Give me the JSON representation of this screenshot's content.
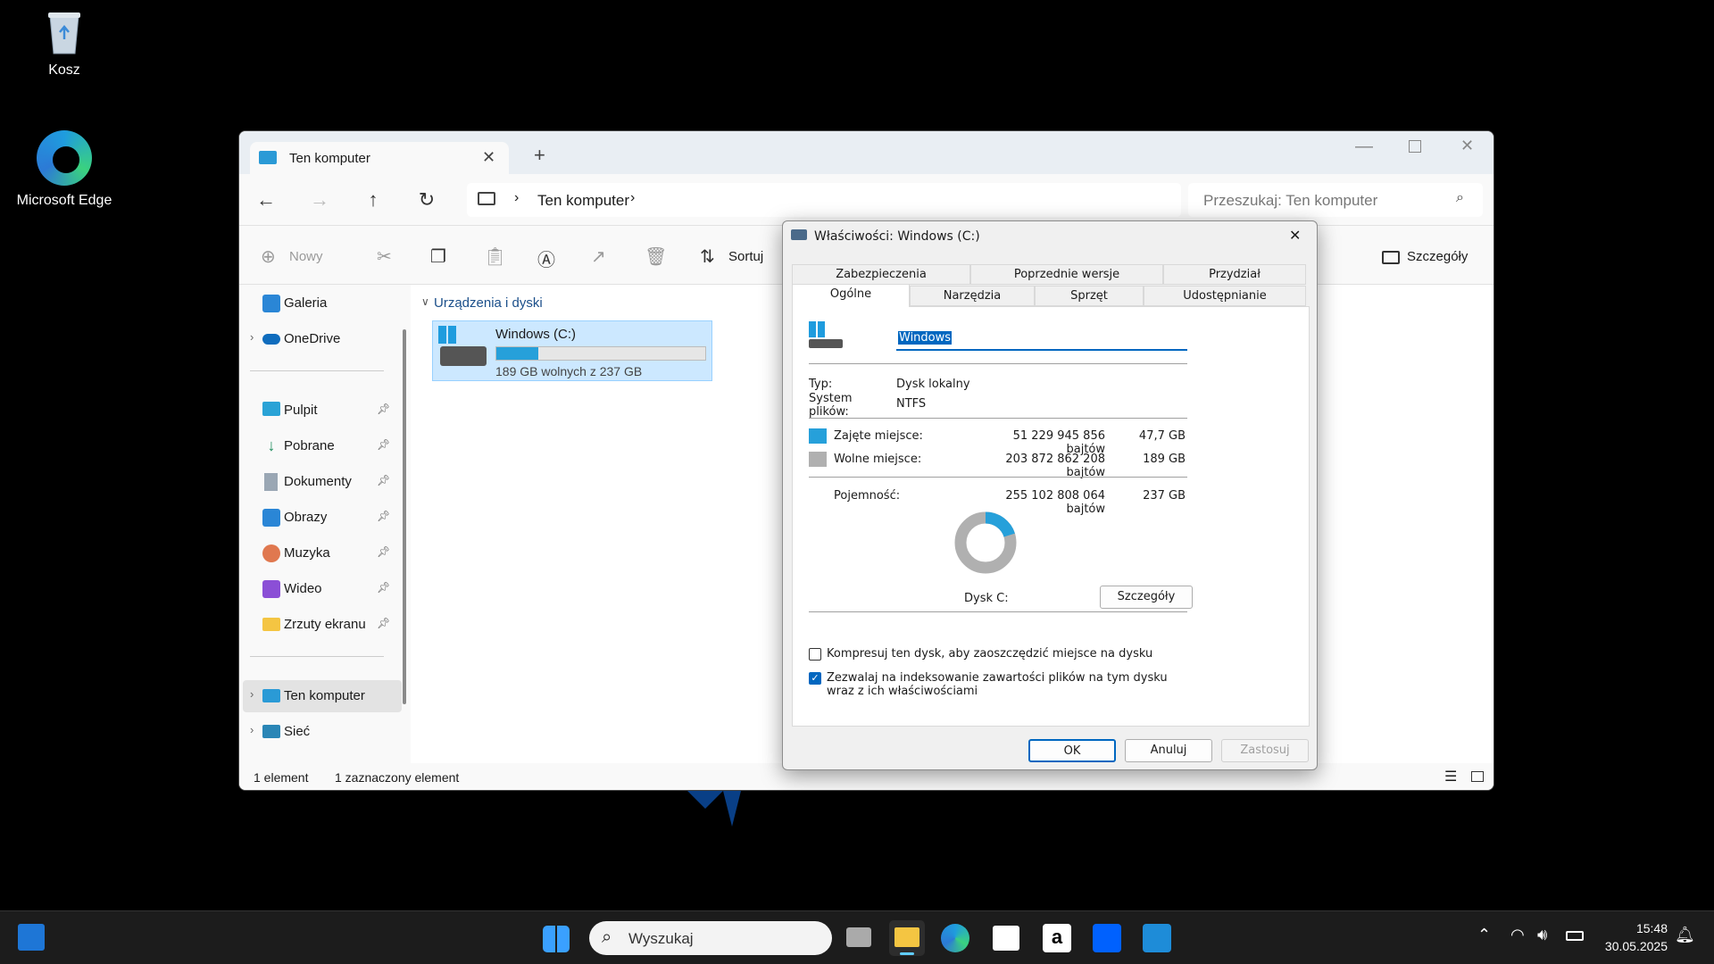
{
  "desktop": {
    "icons": [
      {
        "label": "Kosz",
        "icon": "recycle-bin-icon"
      },
      {
        "label": "Microsoft Edge",
        "icon": "edge-icon"
      }
    ]
  },
  "explorer": {
    "tab_title": "Ten komputer",
    "breadcrumb": [
      "Ten komputer"
    ],
    "search_placeholder": "Przeszukaj: Ten komputer",
    "toolbar": {
      "new_label": "Nowy",
      "sort_label": "Sortuj",
      "details_label": "Szczegóły"
    },
    "sidebar": {
      "top": [
        {
          "label": "Galeria",
          "icon": "gallery-icon",
          "chevron": false
        },
        {
          "label": "OneDrive",
          "icon": "cloud-icon",
          "chevron": true
        }
      ],
      "quick": [
        {
          "label": "Pulpit",
          "icon": "desktop-icon"
        },
        {
          "label": "Pobrane",
          "icon": "download-icon"
        },
        {
          "label": "Dokumenty",
          "icon": "document-icon"
        },
        {
          "label": "Obrazy",
          "icon": "pictures-icon"
        },
        {
          "label": "Muzyka",
          "icon": "music-icon"
        },
        {
          "label": "Wideo",
          "icon": "video-icon"
        },
        {
          "label": "Zrzuty ekranu",
          "icon": "folder-icon"
        }
      ],
      "bottom": [
        {
          "label": "Ten komputer",
          "icon": "computer-icon",
          "selected": true
        },
        {
          "label": "Sieć",
          "icon": "network-icon",
          "selected": false
        }
      ]
    },
    "group_header": "Urządzenia i dyski",
    "drive": {
      "name": "Windows (C:)",
      "free_text": "189 GB wolnych z 237 GB",
      "used_fraction": 0.2
    },
    "status": {
      "count": "1 element",
      "selected": "1 zaznaczony element"
    }
  },
  "dialog": {
    "title": "Właściwości: Windows (C:)",
    "tabs_row1": [
      "Zabezpieczenia",
      "Poprzednie wersje",
      "Przydział"
    ],
    "tabs_row2": [
      "Ogólne",
      "Narzędzia",
      "Sprzęt",
      "Udostępnianie"
    ],
    "active_tab": "Ogólne",
    "volume_name": "Windows",
    "type_label": "Typ:",
    "type_value": "Dysk lokalny",
    "fs_label": "System plików:",
    "fs_value": "NTFS",
    "used_label": "Zajęte miejsce:",
    "used_bytes": "51 229 945 856 bajtów",
    "used_gb": "47,7 GB",
    "free_label": "Wolne miejsce:",
    "free_bytes": "203 872 862 208 bajtów",
    "free_gb": "189 GB",
    "capacity_label": "Pojemność:",
    "capacity_bytes": "255 102 808 064 bajtów",
    "capacity_gb": "237 GB",
    "disk_label": "Dysk C:",
    "details_button": "Szczegóły",
    "compress_label": "Kompresuj ten dysk, aby zaoszczędzić miejsce na dysku",
    "compress_checked": false,
    "index_label": "Zezwalaj na indeksowanie zawartości plików na tym dysku wraz z ich właściwościami",
    "index_checked": true,
    "ok": "OK",
    "cancel": "Anuluj",
    "apply": "Zastosuj",
    "used_fraction": 0.2008,
    "colors": {
      "used": "#26a0da",
      "free": "#b0b0b0"
    }
  },
  "taskbar": {
    "search_placeholder": "Wyszukaj",
    "time": "15:48",
    "date": "30.05.2025"
  }
}
